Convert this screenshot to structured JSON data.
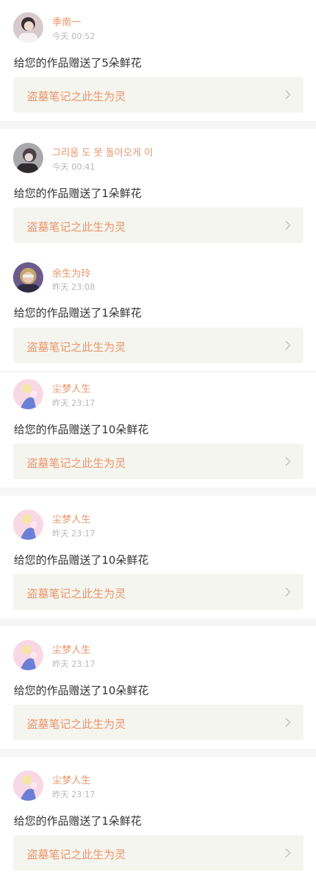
{
  "colors": {
    "accent": "#e9946a",
    "time": "#b8b8b8",
    "text": "#333333",
    "card_bg": "#f5f5ef",
    "separator": "#f6f6f6"
  },
  "notifications": [
    {
      "avatar": "avatar-person-icon",
      "username": "季南一",
      "time": "今天 00:52",
      "message": "给您的作品赠送了5朵鲜花",
      "work_title": "盗墓笔记之此生为灵"
    },
    {
      "avatar": "avatar-person-icon",
      "username": "그리움 도 못 돌아오게 이",
      "time": "今天 00:41",
      "message": "给您的作品赠送了1朵鲜花",
      "work_title": "盗墓笔记之此生为灵"
    },
    {
      "avatar": "avatar-person-icon",
      "username": "余生为玲",
      "time": "昨天 23:08",
      "message": "给您的作品赠送了1朵鲜花",
      "work_title": "盗墓笔记之此生为灵"
    },
    {
      "avatar": "avatar-anime-icon",
      "username": "尘梦人生",
      "time": "昨天 23:17",
      "message": "给您的作品赠送了10朵鲜花",
      "work_title": "盗墓笔记之此生为灵"
    },
    {
      "avatar": "avatar-anime-icon",
      "username": "尘梦人生",
      "time": "昨天 23:17",
      "message": "给您的作品赠送了10朵鲜花",
      "work_title": "盗墓笔记之此生为灵"
    },
    {
      "avatar": "avatar-anime-icon",
      "username": "尘梦人生",
      "time": "昨天 23:17",
      "message": "给您的作品赠送了10朵鲜花",
      "work_title": "盗墓笔记之此生为灵"
    },
    {
      "avatar": "avatar-anime-icon",
      "username": "尘梦人生",
      "time": "昨天 23:17",
      "message": "给您的作品赠送了1朵鲜花",
      "work_title": "盗墓笔记之此生为灵"
    }
  ]
}
